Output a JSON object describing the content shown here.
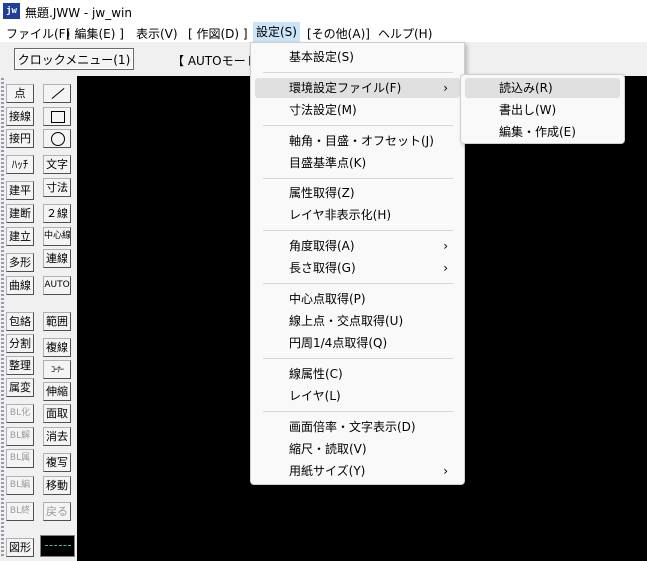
{
  "window": {
    "icon": "jw",
    "title": "無題.JWW - jw_win"
  },
  "menubar": [
    "ファイル(F)",
    "[ 編集(E) ]",
    "表示(V)",
    "[ 作図(D) ]",
    "設定(S)",
    "[その他(A)]",
    "ヘルプ(H)"
  ],
  "toolbar": {
    "clock_menu": "クロックメニュー(1)",
    "auto_mode": "【 AUTOモード"
  },
  "tools": {
    "left": [
      "点",
      "接線",
      "接円",
      "ﾊｯﾁ",
      "建平",
      "建断",
      "建立",
      "多形",
      "曲線",
      "包絡",
      "分割",
      "整理",
      "属変",
      "BL化",
      "BL解",
      "BL属",
      "BL編",
      "BL終",
      "図形"
    ],
    "right": [
      "文字",
      "寸法",
      "２線",
      "中心線",
      "連線",
      "AUTO",
      "範囲",
      "複線",
      "ｺｰﾅｰ",
      "伸縮",
      "面取",
      "消去",
      "複写",
      "移動",
      "戻る"
    ]
  },
  "settings_menu": {
    "items": [
      {
        "label": "基本設定(S)"
      },
      {
        "label": "環境設定ファイル(F)",
        "submenu": true,
        "highlighted": true
      },
      {
        "label": "寸法設定(M)"
      },
      {
        "label": "軸角・目盛・オフセット(J)"
      },
      {
        "label": "目盛基準点(K)"
      },
      {
        "label": "属性取得(Z)"
      },
      {
        "label": "レイヤ非表示化(H)"
      },
      {
        "label": "角度取得(A)",
        "submenu": true
      },
      {
        "label": "長さ取得(G)",
        "submenu": true
      },
      {
        "label": "中心点取得(P)"
      },
      {
        "label": "線上点・交点取得(U)"
      },
      {
        "label": "円周1/4点取得(Q)"
      },
      {
        "label": "線属性(C)"
      },
      {
        "label": "レイヤ(L)"
      },
      {
        "label": "画面倍率・文字表示(D)"
      },
      {
        "label": "縮尺・読取(V)"
      },
      {
        "label": "用紙サイズ(Y)",
        "submenu": true
      }
    ],
    "arrow": "›"
  },
  "env_submenu": {
    "items": [
      {
        "label": "読込み(R)",
        "highlighted": true
      },
      {
        "label": "書出し(W)"
      },
      {
        "label": "編集・作成(E)"
      }
    ]
  }
}
